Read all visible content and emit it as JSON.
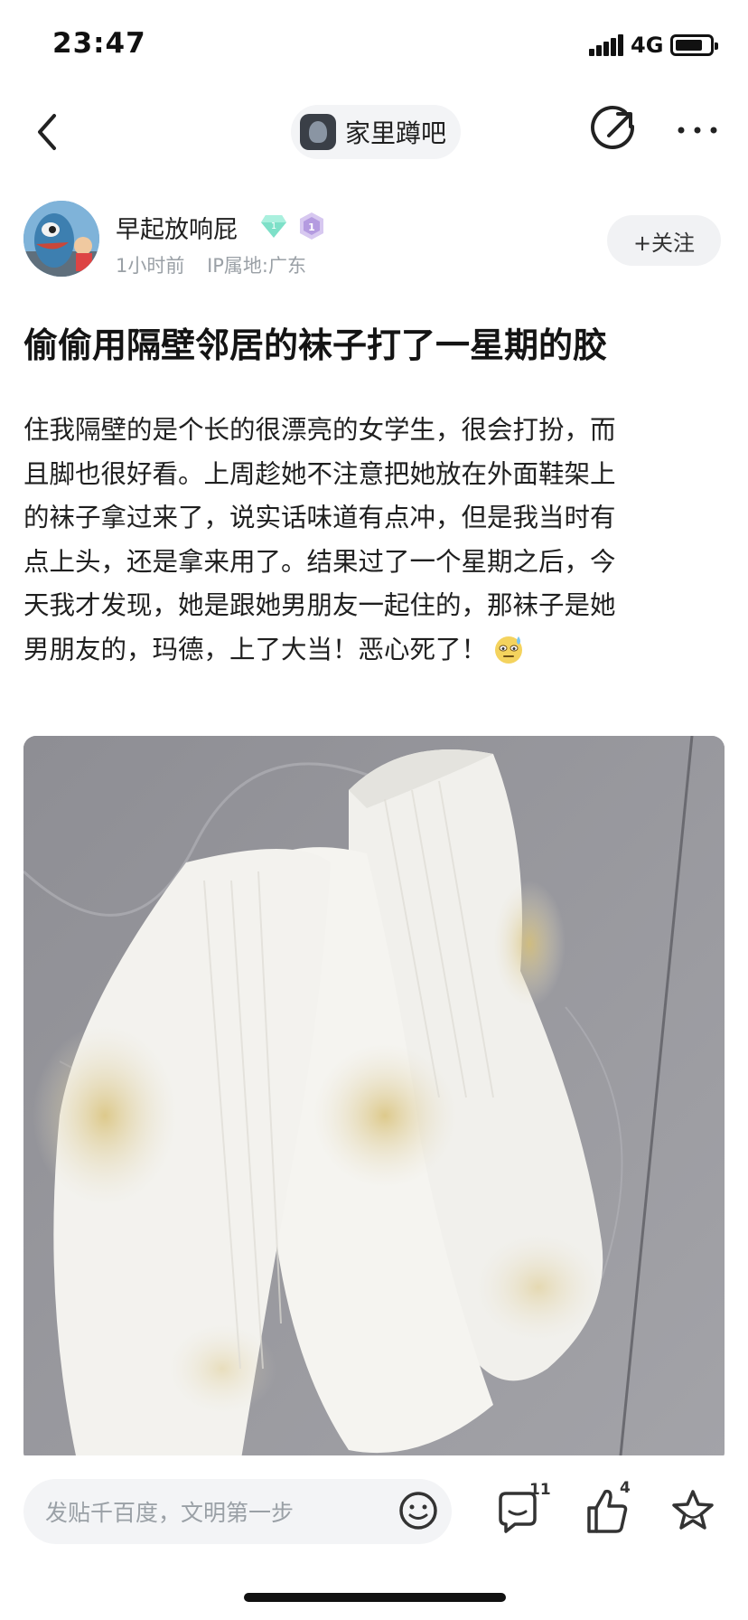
{
  "status_bar": {
    "time": "23:47",
    "network": "4G",
    "battery_level": 0.8,
    "icons": [
      "signal-icon",
      "battery-icon"
    ]
  },
  "nav": {
    "forum_name": "家里蹲吧",
    "icons": [
      "back-arrow-icon",
      "share-icon",
      "more-icon"
    ]
  },
  "author": {
    "name": "早起放响屁",
    "time_ago": "1小时前",
    "ip_location": "IP属地:广东",
    "follow_label": "+关注",
    "level_badge": "1",
    "icons": [
      "gem-badge-icon",
      "level-badge-icon"
    ]
  },
  "post": {
    "title": "偷偷用隔壁邻居的袜子打了一星期的胶",
    "body_lines": [
      "住我隔壁的是个长的很漂亮的女学生，很会打扮，而",
      "且脚也很好看。上周趁她不注意把她放在外面鞋架上",
      "的袜子拿过来了，说实话味道有点冲，但是我当时有",
      "点上头，还是拿来用了。结果过了一个星期之后，今",
      "天我才发现，她是跟她男朋友一起住的，那袜子是她",
      "男朋友的，玛德，上了大当！恶心死了！"
    ],
    "inline_emoji": "sweat-emoji-icon",
    "image": "white-socks-photo"
  },
  "bottom_bar": {
    "comment_placeholder": "发贴千百度，文明第一步",
    "comment_count": "11",
    "like_count": "4",
    "icons": [
      "smiley-icon",
      "comment-icon",
      "like-icon",
      "favorite-star-icon"
    ]
  }
}
